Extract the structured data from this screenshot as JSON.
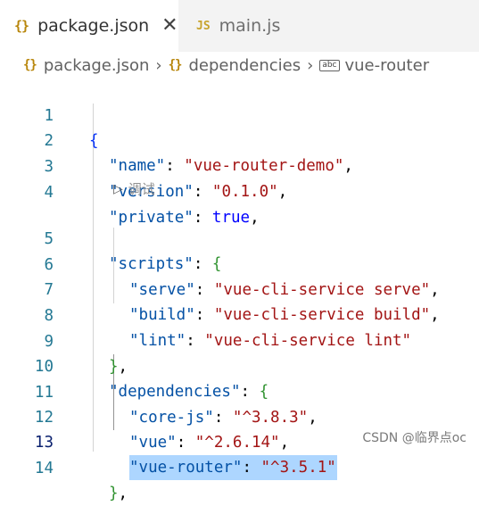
{
  "tabs": [
    {
      "icon": "{}",
      "label": "package.json",
      "close": "✕",
      "active": true
    },
    {
      "icon": "JS",
      "label": "main.js",
      "active": false
    }
  ],
  "breadcrumb": [
    {
      "icon": "{}",
      "label": "package.json"
    },
    {
      "icon": "{}",
      "label": "dependencies"
    },
    {
      "icon": "abc",
      "label": "vue-router"
    }
  ],
  "codelens": "调试",
  "lines": {
    "n1": "1",
    "n2": "2",
    "n3": "3",
    "n4": "4",
    "n5": "5",
    "n6": "6",
    "n7": "7",
    "n8": "8",
    "n9": "9",
    "n10": "10",
    "n11": "11",
    "n12": "12",
    "n13": "13",
    "n14": "14",
    "l1_brace": "{",
    "l2_key": "\"name\"",
    "l2_val": "\"vue-router-demo\"",
    "l3_key": "\"version\"",
    "l3_val": "\"0.1.0\"",
    "l4_key": "\"private\"",
    "l4_val": "true",
    "l5_key": "\"scripts\"",
    "l5_brace": "{",
    "l6_key": "\"serve\"",
    "l6_val": "\"vue-cli-service serve\"",
    "l7_key": "\"build\"",
    "l7_val": "\"vue-cli-service build\"",
    "l8_key": "\"lint\"",
    "l8_val": "\"vue-cli-service lint\"",
    "l9_brace": "}",
    "l10_key": "\"dependencies\"",
    "l10_brace": "{",
    "l11_key": "\"core-js\"",
    "l11_val": "\"^3.8.3\"",
    "l12_key": "\"vue\"",
    "l12_val": "\"^2.6.14\"",
    "l13_key": "\"vue-router\"",
    "l13_val": "\"^3.5.1\"",
    "l14_brace": "}"
  },
  "watermark": "CSDN @临界点oc",
  "colors": {
    "key": "#0451a5",
    "string": "#a31515",
    "boolean": "#0000ff",
    "selection": "#add6ff",
    "line_number": "#237893"
  }
}
